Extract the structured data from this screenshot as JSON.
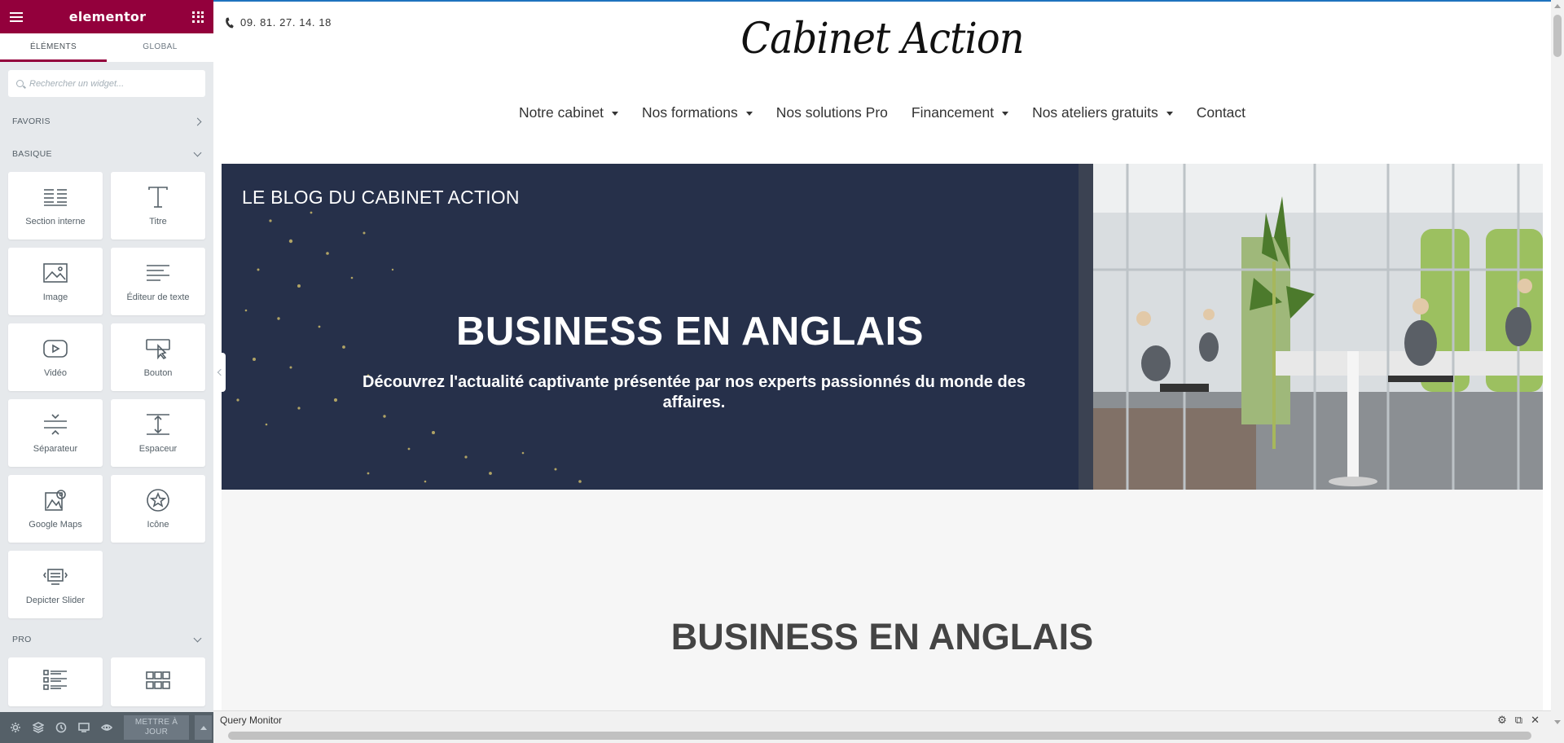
{
  "panel": {
    "brand": "elementor",
    "tabs": [
      {
        "label": "ÉLÉMENTS",
        "active": true
      },
      {
        "label": "GLOBAL",
        "active": false
      }
    ],
    "search": {
      "placeholder": "Rechercher un widget..."
    },
    "categories": {
      "favoris": "FAVORIS",
      "basique": "BASIQUE",
      "pro": "PRO"
    },
    "widgets": [
      {
        "label": "Section interne",
        "icon": "inner-section-icon"
      },
      {
        "label": "Titre",
        "icon": "heading-icon"
      },
      {
        "label": "Image",
        "icon": "image-icon"
      },
      {
        "label": "Éditeur de texte",
        "icon": "text-editor-icon"
      },
      {
        "label": "Vidéo",
        "icon": "video-icon"
      },
      {
        "label": "Bouton",
        "icon": "button-icon"
      },
      {
        "label": "Séparateur",
        "icon": "divider-icon"
      },
      {
        "label": "Espaceur",
        "icon": "spacer-icon"
      },
      {
        "label": "Google Maps",
        "icon": "map-icon"
      },
      {
        "label": "Icône",
        "icon": "star-icon"
      },
      {
        "label": "Depicter Slider",
        "icon": "slider-icon"
      }
    ],
    "footer": {
      "update_label": "METTRE À JOUR",
      "icons": [
        "settings-icon",
        "navigator-icon",
        "history-icon",
        "responsive-icon",
        "preview-icon"
      ]
    },
    "colors": {
      "brand": "#93003c",
      "panel_bg": "#e6e9ec",
      "footer_bg": "#556068"
    }
  },
  "site": {
    "phone": "09. 81. 27. 14. 18",
    "logo_text": "Cabinet Action",
    "nav": [
      {
        "label": "Notre cabinet",
        "dropdown": true
      },
      {
        "label": "Nos formations",
        "dropdown": true
      },
      {
        "label": "Nos solutions Pro",
        "dropdown": false
      },
      {
        "label": "Financement",
        "dropdown": true
      },
      {
        "label": "Nos ateliers gratuits",
        "dropdown": true
      },
      {
        "label": "Contact",
        "dropdown": false
      }
    ],
    "hero": {
      "blog_label": "LE BLOG DU CABINET ACTION",
      "title": "BUSINESS EN ANGLAIS",
      "subtitle": "Découvrez l'actualité captivante présentée par nos experts passionnés du monde des affaires.",
      "bg_color": "#26304a"
    },
    "section2": {
      "heading": "BUSINESS EN ANGLAIS"
    }
  },
  "query_monitor": {
    "label": "Query Monitor"
  }
}
